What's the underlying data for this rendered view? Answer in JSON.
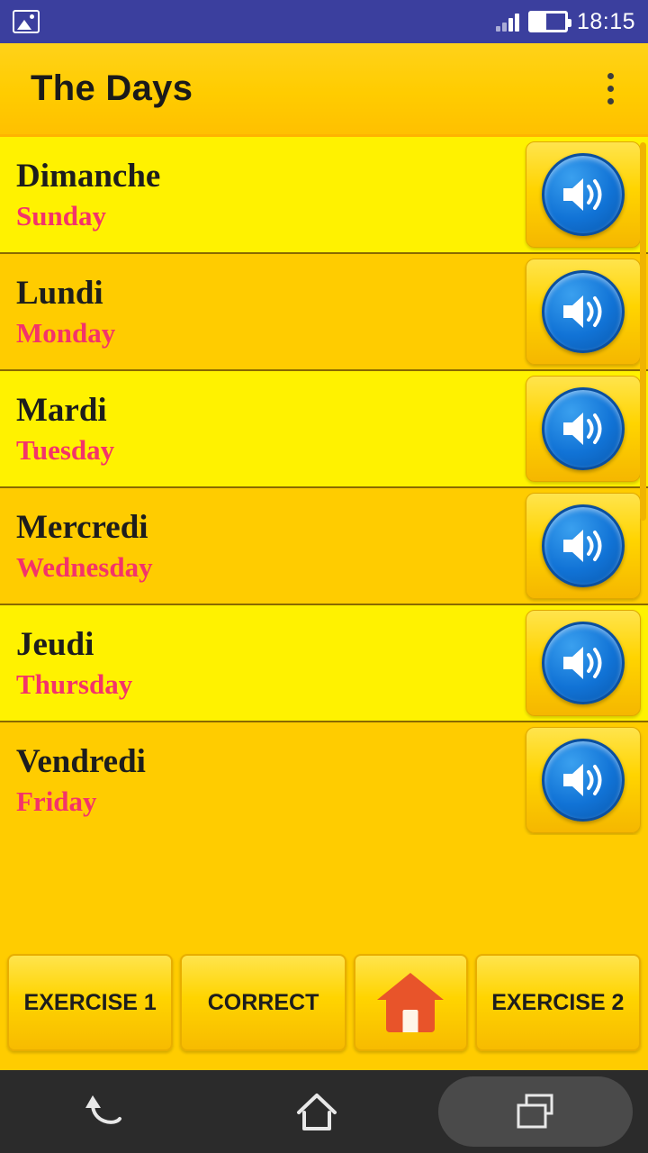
{
  "status_bar": {
    "left_icon": "image-icon",
    "signal_icon": "signal-bars-icon",
    "battery_icon": "battery-icon",
    "time": "18:15"
  },
  "app_bar": {
    "title": "The Days",
    "overflow_icon": "overflow-menu-icon"
  },
  "list": {
    "speaker_icon": "speaker-icon",
    "rows": [
      {
        "french": "Dimanche",
        "english": "Sunday"
      },
      {
        "french": "Lundi",
        "english": "Monday"
      },
      {
        "french": "Mardi",
        "english": "Tuesday"
      },
      {
        "french": "Mercredi",
        "english": "Wednesday"
      },
      {
        "french": "Jeudi",
        "english": "Thursday"
      },
      {
        "french": "Vendredi",
        "english": "Friday"
      }
    ]
  },
  "bottom_bar": {
    "exercise1_label": "EXERCISE 1",
    "correct_label": "CORRECT",
    "home_icon": "home-icon",
    "exercise2_label": "EXERCISE 2"
  },
  "nav_bar": {
    "back_icon": "back-icon",
    "home_icon": "home-icon",
    "recents_icon": "recents-icon"
  },
  "colors": {
    "status_bar": "#3b3f9e",
    "app_yellow": "#ffcc00",
    "row_highlight": "#fff200",
    "english_text": "#f4336a",
    "speaker_blue": "#1173d6",
    "home_red": "#e8542a",
    "nav_bar": "#2b2b2b"
  }
}
